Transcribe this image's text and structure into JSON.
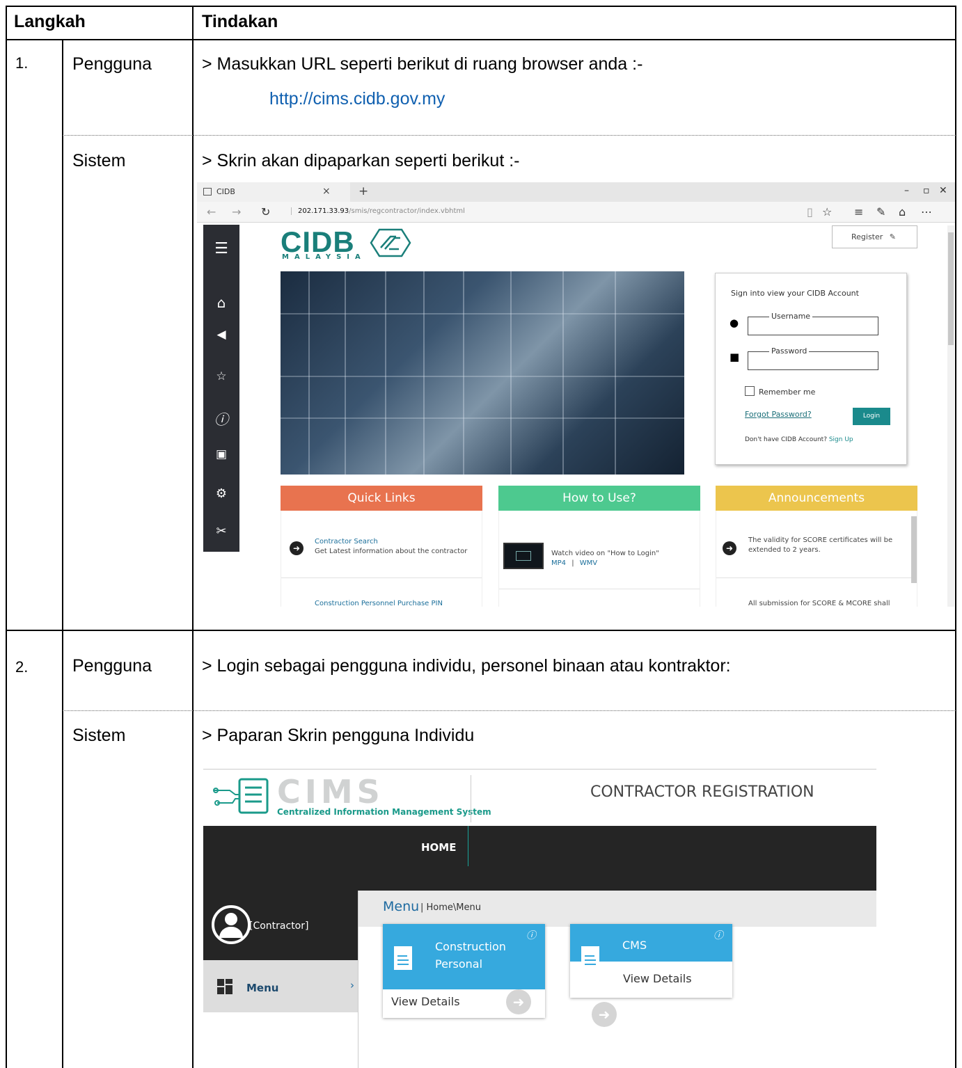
{
  "table": {
    "header": {
      "col1": "Langkah",
      "col2": "Tindakan"
    },
    "rows": [
      {
        "num": "1.",
        "actor": "Pengguna",
        "action": "> Masukkan URL seperti berikut di ruang browser anda :-",
        "url": "http://cims.cidb.gov.my"
      },
      {
        "actor": "Sistem",
        "action": "> Skrin akan dipaparkan seperti berikut :-"
      },
      {
        "num": "2.",
        "actor": "Pengguna",
        "action": "> Login sebagai pengguna individu, personel binaan atau kontraktor:"
      },
      {
        "actor": "Sistem",
        "action": "> Paparan Skrin pengguna Individu"
      }
    ]
  },
  "browser": {
    "tab_title": "CIDB",
    "tab_close": "×",
    "tab_new": "+",
    "url_host": "202.171.33.93",
    "url_path": "/smis/regcontractor/index.vbhtml",
    "site": {
      "logo_text": "CIDB",
      "logo_sub": "MALAYSIA",
      "register": "Register",
      "login": {
        "title": "Sign into view your CIDB Account",
        "username_label": "Username",
        "password_label": "Password",
        "remember": "Remember me",
        "forgot": "Forgot Password?",
        "button": "Login",
        "no_account": "Don't have CIDB Account?",
        "signup": "Sign Up"
      },
      "panels": {
        "quick": {
          "title": "Quick Links",
          "color": "#e8734f",
          "item_title": "Contractor Search",
          "item_text": "Get Latest information about the contractor",
          "item2": "Construction Personnel Purchase PIN"
        },
        "howto": {
          "title": "How to Use?",
          "color": "#4dc98f",
          "item_text": "Watch video on \"How to Login\"",
          "mp4": "MP4",
          "sep": "|",
          "wmv": "WMV"
        },
        "ann": {
          "title": "Announcements",
          "color": "#ecc54d",
          "item_text1": "The validity for SCORE certificates will be",
          "item_text2": "extended to 2 years.",
          "item2": "All submission for SCORE & MCORE shall"
        }
      }
    }
  },
  "cims": {
    "logo_word": "CIMS",
    "logo_sub": "Centralized Information Management System",
    "title": "CONTRACTOR REGISTRATION",
    "nav_home": "HOME",
    "user_role": "[Contractor]",
    "side_menu": "Menu",
    "side_chevron": "›",
    "breadcrumb_title": "Menu",
    "breadcrumb_path": "| Home\\Menu",
    "cards": [
      {
        "title": "Construction\nPersonal",
        "link": "View Details"
      },
      {
        "title": "CMS",
        "link": "View Details"
      }
    ]
  }
}
